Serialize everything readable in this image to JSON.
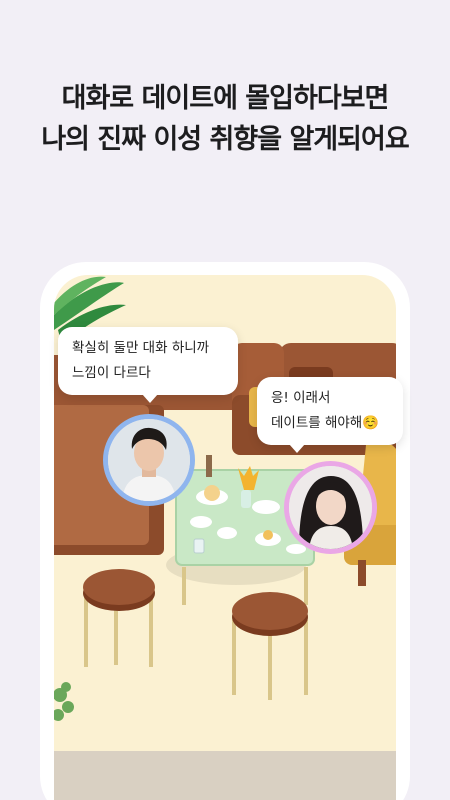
{
  "headline": {
    "line1": "대화로 데이트에 몰입하다보면",
    "line2": "나의 진짜 이성 취향을 알게되어요"
  },
  "chat": {
    "male_bubble": {
      "line1": "확실히 둘만 대화 하니까",
      "line2": "느낌이 다르다"
    },
    "female_bubble": {
      "line1": "응! 이래서",
      "line2": "데이트를 해야해☺️"
    }
  },
  "avatars": {
    "male": {
      "name": "male-avatar",
      "border_color": "#8fb5ee"
    },
    "female": {
      "name": "female-avatar",
      "border_color": "#eaa7e6"
    }
  },
  "colors": {
    "background": "#f2eff6",
    "scene_floor": "#fbf1d2",
    "sofa": "#9b5634",
    "table_glass": "#c9e8c6"
  }
}
